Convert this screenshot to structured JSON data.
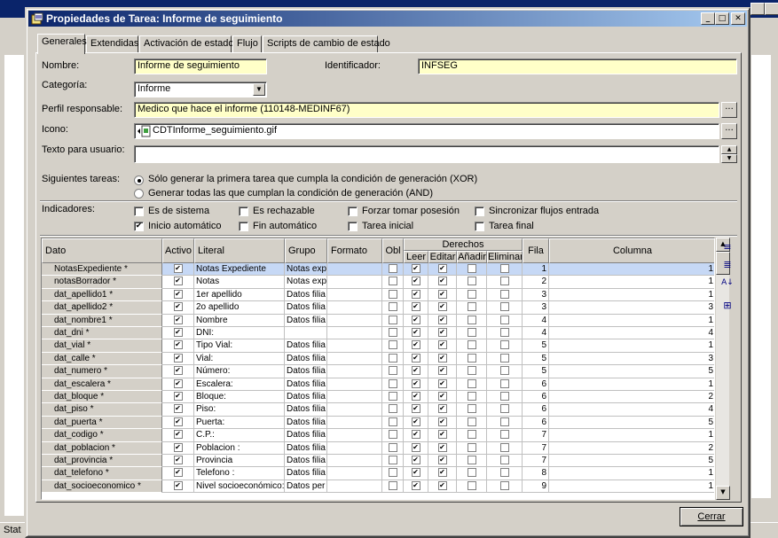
{
  "background": {
    "status_text": "Stat"
  },
  "dialog": {
    "title": "Propiedades de Tarea: Informe de seguimiento",
    "title_icon": "property-sheet-icon",
    "controls": {
      "minimize": "_",
      "maximize": "□",
      "close": "✕"
    }
  },
  "tabs": [
    {
      "label": "Generales",
      "active": true
    },
    {
      "label": "Extendidas",
      "active": false
    },
    {
      "label": "Activación de estados",
      "active": false
    },
    {
      "label": "Flujo",
      "active": false
    },
    {
      "label": "Scripts de cambio de estado",
      "active": false
    }
  ],
  "form": {
    "nombre_label": "Nombre:",
    "nombre_value": "Informe de seguimiento",
    "identificador_label": "Identificador:",
    "identificador_value": "INFSEG",
    "categoria_label": "Categoría:",
    "categoria_value": "Informe",
    "perfil_label": "Perfil responsable:",
    "perfil_value": "Medico que hace el informe (110148-MEDINF67)",
    "icono_label": "Icono:",
    "icono_value": "CDTInforme_seguimiento.gif",
    "texto_label": "Texto para usuario:",
    "texto_value": "",
    "ellipsis": "...",
    "siguientes_label": "Siguientes tareas:",
    "radio_xor": "Sólo generar la primera tarea que cumpla la condición de generación (XOR)",
    "radio_and": "Generar todas las que cumplan la condición de generación (AND)",
    "radio_selected": "xor",
    "indicadores_label": "Indicadores:",
    "indicadores": [
      {
        "label": "Es de sistema",
        "checked": false
      },
      {
        "label": "Es rechazable",
        "checked": false
      },
      {
        "label": "Forzar tomar posesión",
        "checked": false
      },
      {
        "label": "Sincronizar flujos entrada",
        "checked": false
      },
      {
        "label": "Inicio automático",
        "checked": true
      },
      {
        "label": "Fin automático",
        "checked": false
      },
      {
        "label": "Tarea inicial",
        "checked": false
      },
      {
        "label": "Tarea final",
        "checked": false
      }
    ]
  },
  "grid": {
    "headers": {
      "dato": "Dato",
      "activo": "Activo",
      "literal": "Literal",
      "grupo": "Grupo",
      "formato": "Formato",
      "obl": "Obl",
      "derechos": "Derechos",
      "leer": "Leer",
      "editar": "Editar",
      "anadir": "Añadir",
      "eliminar": "Eliminar",
      "fila": "Fila",
      "columna": "Columna"
    },
    "selected_row": 0,
    "rows": [
      {
        "dato": "NotasExpediente *",
        "activo": true,
        "literal": "Notas Expediente",
        "grupo": "Notas exp",
        "formato": "",
        "obl": false,
        "leer": true,
        "editar": true,
        "anadir": false,
        "eliminar": false,
        "fila": "1",
        "columna": "1"
      },
      {
        "dato": "notasBorrador *",
        "activo": true,
        "literal": "Notas",
        "grupo": "Notas exp",
        "formato": "",
        "obl": false,
        "leer": true,
        "editar": true,
        "anadir": false,
        "eliminar": false,
        "fila": "2",
        "columna": "1"
      },
      {
        "dato": "dat_apellido1 *",
        "activo": true,
        "literal": "1er apellido",
        "grupo": "Datos filia",
        "formato": "",
        "obl": false,
        "leer": true,
        "editar": true,
        "anadir": false,
        "eliminar": false,
        "fila": "3",
        "columna": "1"
      },
      {
        "dato": "dat_apellido2 *",
        "activo": true,
        "literal": "2o apellido",
        "grupo": "Datos filia",
        "formato": "",
        "obl": false,
        "leer": true,
        "editar": true,
        "anadir": false,
        "eliminar": false,
        "fila": "3",
        "columna": "3"
      },
      {
        "dato": "dat_nombre1 *",
        "activo": true,
        "literal": "Nombre",
        "grupo": "Datos filia",
        "formato": "",
        "obl": false,
        "leer": true,
        "editar": true,
        "anadir": false,
        "eliminar": false,
        "fila": "4",
        "columna": "1"
      },
      {
        "dato": "dat_dni *",
        "activo": true,
        "literal": "DNI:",
        "grupo": "",
        "formato": "",
        "obl": false,
        "leer": true,
        "editar": true,
        "anadir": false,
        "eliminar": false,
        "fila": "4",
        "columna": "4"
      },
      {
        "dato": "dat_vial *",
        "activo": true,
        "literal": "Tipo Vial:",
        "grupo": "Datos filia",
        "formato": "",
        "obl": false,
        "leer": true,
        "editar": true,
        "anadir": false,
        "eliminar": false,
        "fila": "5",
        "columna": "1"
      },
      {
        "dato": "dat_calle *",
        "activo": true,
        "literal": "Vial:",
        "grupo": "Datos filia",
        "formato": "",
        "obl": false,
        "leer": true,
        "editar": true,
        "anadir": false,
        "eliminar": false,
        "fila": "5",
        "columna": "3"
      },
      {
        "dato": "dat_numero *",
        "activo": true,
        "literal": "Número:",
        "grupo": "Datos filia",
        "formato": "",
        "obl": false,
        "leer": true,
        "editar": true,
        "anadir": false,
        "eliminar": false,
        "fila": "5",
        "columna": "5"
      },
      {
        "dato": "dat_escalera *",
        "activo": true,
        "literal": "Escalera:",
        "grupo": "Datos filia",
        "formato": "",
        "obl": false,
        "leer": true,
        "editar": true,
        "anadir": false,
        "eliminar": false,
        "fila": "6",
        "columna": "1"
      },
      {
        "dato": "dat_bloque *",
        "activo": true,
        "literal": "Bloque:",
        "grupo": "Datos filia",
        "formato": "",
        "obl": false,
        "leer": true,
        "editar": true,
        "anadir": false,
        "eliminar": false,
        "fila": "6",
        "columna": "2"
      },
      {
        "dato": "dat_piso *",
        "activo": true,
        "literal": "Piso:",
        "grupo": "Datos filia",
        "formato": "",
        "obl": false,
        "leer": true,
        "editar": true,
        "anadir": false,
        "eliminar": false,
        "fila": "6",
        "columna": "4"
      },
      {
        "dato": "dat_puerta *",
        "activo": true,
        "literal": "Puerta:",
        "grupo": "Datos filia",
        "formato": "",
        "obl": false,
        "leer": true,
        "editar": true,
        "anadir": false,
        "eliminar": false,
        "fila": "6",
        "columna": "5"
      },
      {
        "dato": "dat_codigo *",
        "activo": true,
        "literal": "C.P.:",
        "grupo": "Datos filia",
        "formato": "",
        "obl": false,
        "leer": true,
        "editar": true,
        "anadir": false,
        "eliminar": false,
        "fila": "7",
        "columna": "1"
      },
      {
        "dato": "dat_poblacion *",
        "activo": true,
        "literal": "Poblacion :",
        "grupo": "Datos filia",
        "formato": "",
        "obl": false,
        "leer": true,
        "editar": true,
        "anadir": false,
        "eliminar": false,
        "fila": "7",
        "columna": "2"
      },
      {
        "dato": "dat_provincia *",
        "activo": true,
        "literal": "Provincia",
        "grupo": "Datos filia",
        "formato": "",
        "obl": false,
        "leer": true,
        "editar": true,
        "anadir": false,
        "eliminar": false,
        "fila": "7",
        "columna": "5"
      },
      {
        "dato": "dat_telefono *",
        "activo": true,
        "literal": "Telefono :",
        "grupo": "Datos filia",
        "formato": "",
        "obl": false,
        "leer": true,
        "editar": true,
        "anadir": false,
        "eliminar": false,
        "fila": "8",
        "columna": "1"
      },
      {
        "dato": "dat_socioeconomico *",
        "activo": true,
        "literal": "Nivel socioeconómico:",
        "grupo": "Datos per",
        "formato": "",
        "obl": false,
        "leer": true,
        "editar": true,
        "anadir": false,
        "eliminar": false,
        "fila": "9",
        "columna": "1"
      }
    ]
  },
  "side_tools": [
    "add-row-icon",
    "insert-row-icon",
    "sort-az-icon",
    "tree-structure-icon"
  ],
  "buttons": {
    "cerrar": "Cerrar"
  }
}
